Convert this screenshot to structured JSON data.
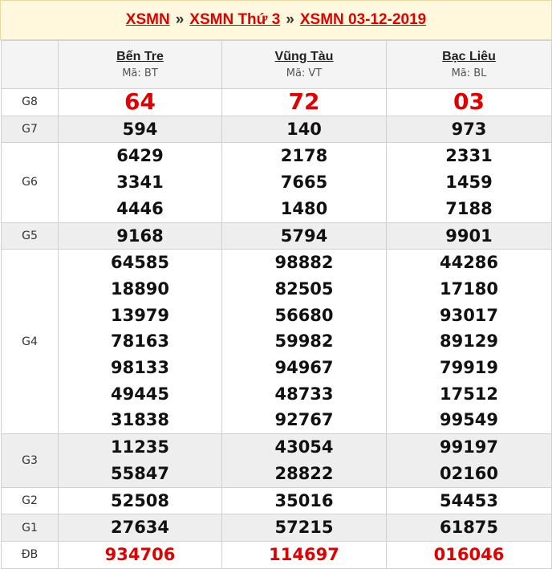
{
  "breadcrumb": {
    "items": [
      "XSMN",
      "XSMN Thứ 3",
      "XSMN 03-12-2019"
    ],
    "separator": "»"
  },
  "provinces": [
    {
      "name": "Bến Tre",
      "code": "Mã: BT"
    },
    {
      "name": "Vũng Tàu",
      "code": "Mã: VT"
    },
    {
      "name": "Bạc Liêu",
      "code": "Mã: BL"
    }
  ],
  "prizes": [
    {
      "label": "G8",
      "values": [
        [
          "64"
        ],
        [
          "72"
        ],
        [
          "03"
        ]
      ]
    },
    {
      "label": "G7",
      "values": [
        [
          "594"
        ],
        [
          "140"
        ],
        [
          "973"
        ]
      ]
    },
    {
      "label": "G6",
      "values": [
        [
          "6429",
          "3341",
          "4446"
        ],
        [
          "2178",
          "7665",
          "1480"
        ],
        [
          "2331",
          "1459",
          "7188"
        ]
      ]
    },
    {
      "label": "G5",
      "values": [
        [
          "9168"
        ],
        [
          "5794"
        ],
        [
          "9901"
        ]
      ]
    },
    {
      "label": "G4",
      "values": [
        [
          "64585",
          "18890",
          "13979",
          "78163",
          "98133",
          "49445",
          "31838"
        ],
        [
          "98882",
          "82505",
          "56680",
          "59982",
          "94967",
          "48733",
          "92767"
        ],
        [
          "44286",
          "17180",
          "93017",
          "89129",
          "79919",
          "17512",
          "99549"
        ]
      ]
    },
    {
      "label": "G3",
      "values": [
        [
          "11235",
          "55847"
        ],
        [
          "43054",
          "28822"
        ],
        [
          "99197",
          "02160"
        ]
      ]
    },
    {
      "label": "G2",
      "values": [
        [
          "52508"
        ],
        [
          "35016"
        ],
        [
          "54453"
        ]
      ]
    },
    {
      "label": "G1",
      "values": [
        [
          "27634"
        ],
        [
          "57215"
        ],
        [
          "61875"
        ]
      ]
    },
    {
      "label": "ĐB",
      "values": [
        [
          "934706"
        ],
        [
          "114697"
        ],
        [
          "016046"
        ]
      ]
    }
  ],
  "colors": {
    "accent": "#e00000",
    "header_bg": "#fff8dc",
    "alt_row": "#eeeeee"
  }
}
